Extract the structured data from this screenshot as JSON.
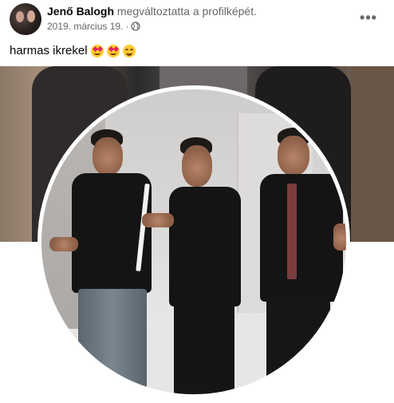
{
  "post": {
    "author": "Jenő Balogh",
    "action": "megváltoztatta a profilképét.",
    "date": "2019. március 19.",
    "separator": "·",
    "privacy_icon": "globe-icon",
    "more_icon": "more-horizontal-icon",
    "more_label": "•••",
    "caption": "harmas ikrekel",
    "caption_emojis": [
      "heart-eyes-emoji",
      "heart-eyes-emoji",
      "grinning-emoji"
    ]
  },
  "colors": {
    "text_primary": "#050505",
    "text_secondary": "#65676b",
    "background": "#ffffff",
    "emoji_yellow": "#ffcc33",
    "emoji_heart": "#e0245e"
  }
}
